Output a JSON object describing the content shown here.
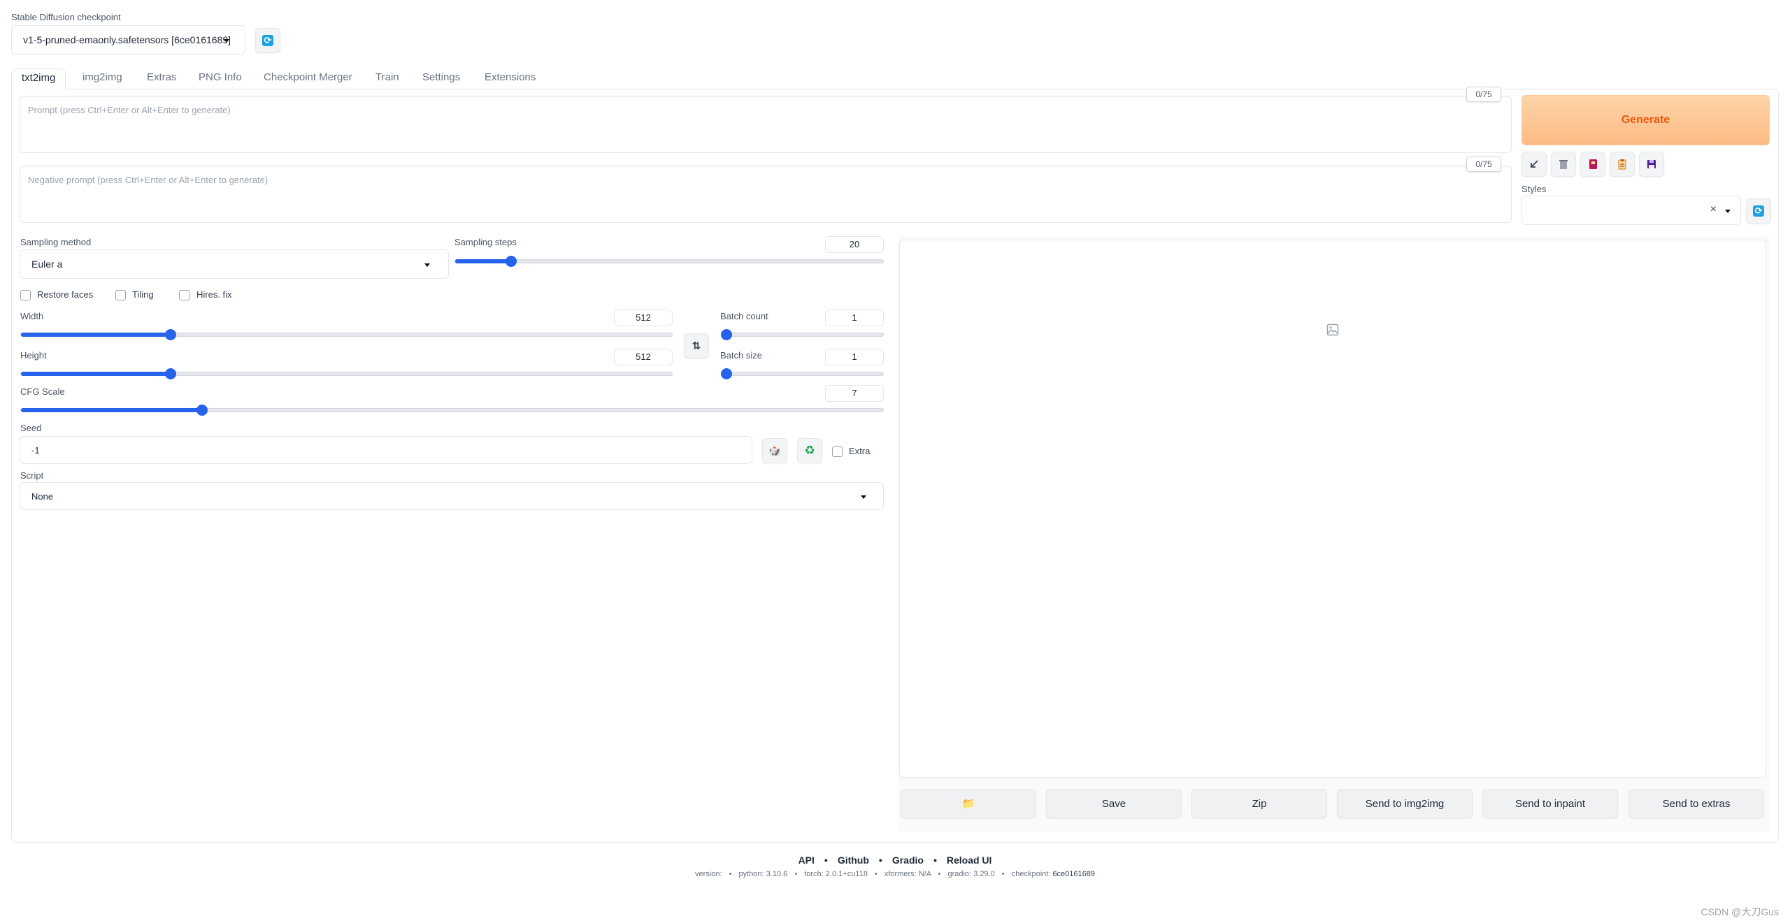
{
  "checkpoint": {
    "label": "Stable Diffusion checkpoint",
    "value": "v1-5-pruned-emaonly.safetensors [6ce0161689]"
  },
  "tabs": [
    "txt2img",
    "img2img",
    "Extras",
    "PNG Info",
    "Checkpoint Merger",
    "Train",
    "Settings",
    "Extensions"
  ],
  "active_tab": "txt2img",
  "prompt": {
    "placeholder": "Prompt (press Ctrl+Enter or Alt+Enter to generate)",
    "counter": "0/75"
  },
  "negative_prompt": {
    "placeholder": "Negative prompt (press Ctrl+Enter or Alt+Enter to generate)",
    "counter": "0/75"
  },
  "generate_label": "Generate",
  "tool_icons": [
    "arrow-icon",
    "trash-icon",
    "book-icon",
    "clipboard-icon",
    "save-icon"
  ],
  "styles": {
    "label": "Styles",
    "clear": "×"
  },
  "sampling_method": {
    "label": "Sampling method",
    "value": "Euler a"
  },
  "sampling_steps": {
    "label": "Sampling steps",
    "value": "20",
    "fraction": 0.13
  },
  "checkboxes": {
    "restore_faces": "Restore faces",
    "tiling": "Tiling",
    "hires_fix": "Hires. fix"
  },
  "width": {
    "label": "Width",
    "value": "512",
    "fraction": 0.23
  },
  "height": {
    "label": "Height",
    "value": "512",
    "fraction": 0.23
  },
  "batch_count": {
    "label": "Batch count",
    "value": "1",
    "fraction": 0.0
  },
  "batch_size": {
    "label": "Batch size",
    "value": "1",
    "fraction": 0.0
  },
  "cfg_scale": {
    "label": "CFG Scale",
    "value": "7",
    "fraction": 0.21
  },
  "seed": {
    "label": "Seed",
    "value": "-1",
    "extra_label": "Extra"
  },
  "script": {
    "label": "Script",
    "value": "None"
  },
  "actions": {
    "folder": "📁",
    "save": "Save",
    "zip": "Zip",
    "send_img2img": "Send to img2img",
    "send_inpaint": "Send to inpaint",
    "send_extras": "Send to extras"
  },
  "footer": {
    "links": [
      "API",
      "Github",
      "Gradio",
      "Reload UI"
    ],
    "version_label": "version:",
    "version_value": "",
    "python": "python: 3.10.6",
    "torch": "torch: 2.0.1+cu118",
    "xformers": "xformers: N/A",
    "gradio": "gradio: 3.29.0",
    "checkpoint_label": "checkpoint:",
    "checkpoint_value": "6ce0161689"
  },
  "watermark": "CSDN @大刀Gus",
  "colors": {
    "accent": "#2563eb",
    "generate": "#ea580c",
    "refresh": "#1e9fe0"
  }
}
